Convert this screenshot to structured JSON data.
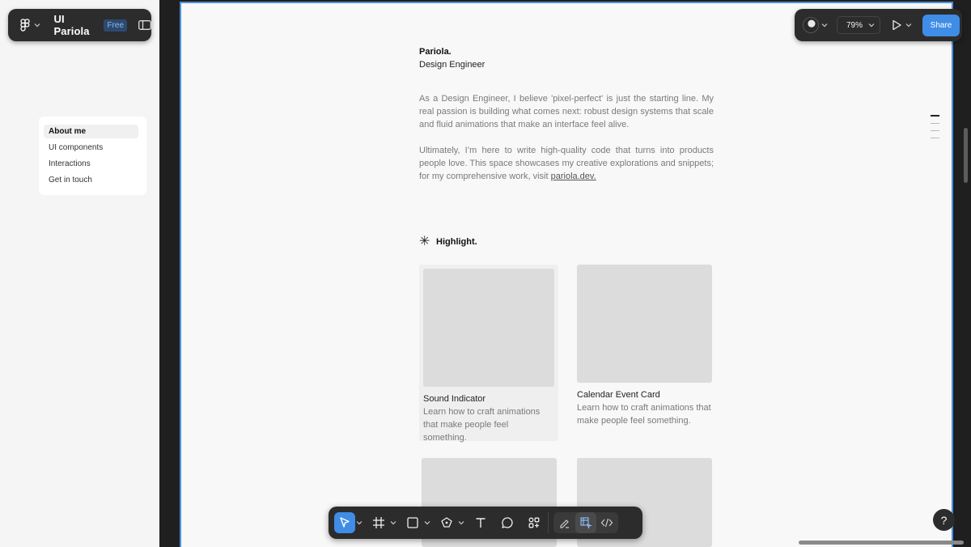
{
  "file": {
    "name": "UI Pariola",
    "plan_badge": "Free"
  },
  "sidebar": {
    "items": [
      {
        "label": "About me",
        "active": true
      },
      {
        "label": "UI components",
        "active": false
      },
      {
        "label": "Interactions",
        "active": false
      },
      {
        "label": "Get in touch",
        "active": false
      }
    ]
  },
  "topbar": {
    "zoom": "79%",
    "share_label": "Share"
  },
  "profile": {
    "name": "Pariola.",
    "role": "Design Engineer",
    "paragraph1": "As a Design Engineer, I believe 'pixel-perfect' is just the starting line. My real passion is building what comes next: robust design systems that scale and fluid animations that make an interface feel alive.",
    "paragraph2_prefix": "Ultimately, I’m here to write high-quality code that turns into products people love. This space showcases my creative explorations and snippets; for my comprehensive work, visit ",
    "link_text": "pariola.dev."
  },
  "highlight": {
    "heading": "Highlight.",
    "cards": [
      {
        "title": "Sound Indicator",
        "desc": "Learn how to craft animations that make people feel something."
      },
      {
        "title": "Calendar Event Card",
        "desc": "Learn how to craft animations that make people feel something."
      }
    ]
  },
  "toolbar": {
    "tools": [
      "move-tool",
      "frame-tool",
      "shape-tool",
      "pen-tool",
      "text-tool",
      "comment-tool",
      "actions-tool"
    ],
    "modes": [
      "draw-mode",
      "design-mode",
      "dev-mode"
    ]
  },
  "help_label": "?",
  "colors": {
    "accent": "#3f8de6",
    "canvas": "#f8f8f8",
    "ui_dark": "#2c2c2c"
  }
}
